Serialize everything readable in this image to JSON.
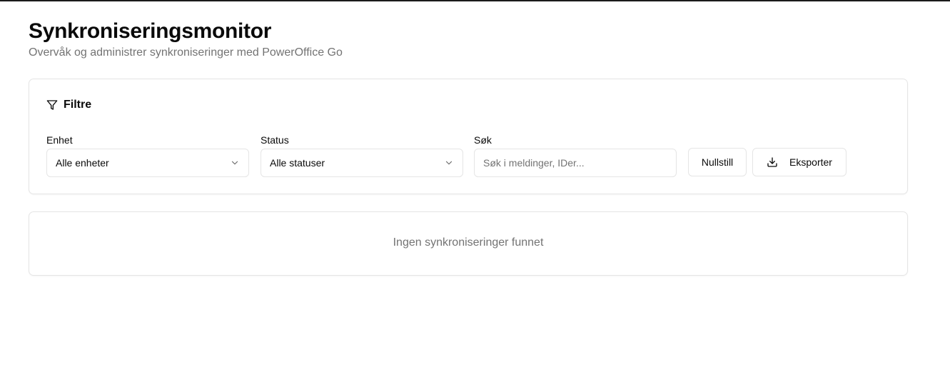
{
  "header": {
    "title": "Synkroniseringsmonitor",
    "subtitle": "Overvåk og administrer synkroniseringer med PowerOffice Go"
  },
  "filters": {
    "heading": "Filtre",
    "heading_icon": "filter-icon",
    "unit": {
      "label": "Enhet",
      "selected": "Alle enheter"
    },
    "status": {
      "label": "Status",
      "selected": "Alle statuser"
    },
    "search": {
      "label": "Søk",
      "value": "",
      "placeholder": "Søk i meldinger, IDer..."
    },
    "reset_label": "Nullstill",
    "export_label": "Eksporter",
    "export_icon": "download-icon"
  },
  "results": {
    "empty_message": "Ingen synkroniseringer funnet"
  },
  "colors": {
    "text": "#0a0a0a",
    "muted": "#737373",
    "border": "#e5e5e5",
    "background": "#ffffff"
  }
}
